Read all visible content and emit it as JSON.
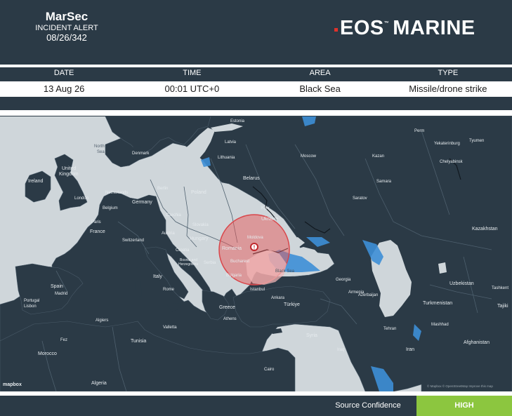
{
  "header": {
    "title": "MarSec",
    "subtitle": "INCIDENT ALERT",
    "alert_number": "08/26/342",
    "logo_text": "EOS",
    "logo_text2": "MARINE",
    "brand_accent": "#e0322b"
  },
  "incident": {
    "columns": [
      "DATE",
      "TIME",
      "AREA",
      "TYPE"
    ],
    "values": [
      "13 Aug 26",
      "00:01 UTC+0",
      "Black Sea",
      "Missile/drone strike"
    ]
  },
  "map": {
    "labels": {
      "estonia": "Estonia",
      "latvia": "Latvia",
      "lithuania": "Lithuania",
      "denmark": "Denmark",
      "north_sea": "North",
      "north_sea2": "Sea",
      "united_kingdom": "United",
      "united_kingdom2": "Kingdom",
      "ireland": "Ireland",
      "london": "London",
      "netherlands": "Netherlands",
      "belgium": "Belgium",
      "germany": "Germany",
      "berlin": "Berlin",
      "poland": "Poland",
      "belarus": "Belarus",
      "moscow": "Moscow",
      "kazan": "Kazan",
      "perm": "Perm",
      "yekaterinburg": "Yekaterinburg",
      "tyumen": "Tyumen",
      "chelyabinsk": "Chelyabinsk",
      "samara": "Samara",
      "saratov": "Saratov",
      "kyiv": "Kyiv",
      "ukraine": "Ukraine",
      "france": "France",
      "paris": "Paris",
      "czechia": "Czechia",
      "slovakia": "Slovakia",
      "austria": "Austria",
      "switzerland": "Switzerland",
      "hungary": "Hungary",
      "moldova": "Moldova",
      "romania": "Romania",
      "croatia": "Croatia",
      "bosnia": "Bosnia and",
      "herzegovina": "Herzegovina",
      "serbia": "Serbia",
      "bucharest": "Bucharest",
      "bulgaria": "Bulgaria",
      "black_sea": "Black Sea",
      "italy": "Italy",
      "rome": "Rome",
      "spain": "Spain",
      "madrid": "Madrid",
      "portugal": "Portugal",
      "lisbon": "Lisbon",
      "istanbul": "Istanbul",
      "ankara": "Ankara",
      "turkiye": "Türkiye",
      "greece": "Greece",
      "athens": "Athens",
      "georgia": "Georgia",
      "armenia": "Armenia",
      "azerbaijan": "Azerbaijan",
      "syria": "Syria",
      "iraq": "Iraq",
      "cairo": "Cairo",
      "kazakhstan": "Kazakhstan",
      "uzbekistan": "Uzbekistan",
      "turkmenistan": "Turkmenistan",
      "tashkent": "Tashkent",
      "tajik": "Tajiki",
      "tehran": "Tehran",
      "mashhad": "Mashhad",
      "iran": "Iran",
      "afghanistan": "Afghanistan",
      "tunisia": "Tunisia",
      "algiers": "Algiers",
      "valletta": "Valletta",
      "morocco": "Morocco",
      "fez": "Fez",
      "algeria": "Algeria",
      "mapbox": "mapbox",
      "attribution": "© Mapbox © OpenStreetMap  Improve this map"
    },
    "incident_marker": "!"
  },
  "footer": {
    "source_label": "Source Confidence",
    "source_value": "HIGH",
    "high_color": "#8cc63f"
  }
}
